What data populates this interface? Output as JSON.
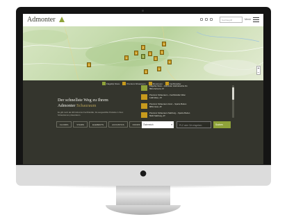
{
  "header": {
    "logo_text": "Admonter",
    "search_placeholder": "Suchbegriff",
    "menu_label": "Menü"
  },
  "map": {
    "markers": [
      "1",
      "1",
      "1",
      "2",
      "1",
      "1",
      "1",
      "1",
      "1",
      "1",
      "1",
      "1"
    ],
    "zoom_label": "+\n−"
  },
  "legend": {
    "items": [
      "Flagship Store",
      "Premium Showroom",
      "Showroom",
      "Fachhändler"
    ]
  },
  "hero": {
    "headline_line1": "Der schnellste Weg zu Ihrem",
    "headline_brand": "Admonter",
    "headline_accent": "Schauraum",
    "subtext": "Es gibt mehr als 400 Admonter Fachhändler, die ausgewählte Produkte in ihren Schauräumen präsentieren."
  },
  "filters": {
    "tabs": [
      "FLOORS",
      "STAIRS",
      "ELEMENTS",
      "ACOUSTICS",
      "DOORS",
      "IN"
    ]
  },
  "results": [
    {
      "title": "Flagship Store – Admonter Holzindustrie AG",
      "address": "8911 Admont, AT"
    },
    {
      "title": "Premium Schauraum – Fachhändler Wien",
      "address": "1100 Wien, AT"
    },
    {
      "title": "Premium Schauraum Graz – Sparte Boden",
      "address": "8051 Graz, AT"
    },
    {
      "title": "Premium Schauraum Salzburg – Sparte Boden",
      "address": "5020 Salzburg, AT"
    }
  ],
  "search": {
    "country_selected": "Österreich",
    "zip_placeholder": "PLZ oder Ort eingeben",
    "go_label": "Suchen"
  },
  "colors": {
    "accent_green": "#8fa33a",
    "marker_gold": "#c79a1d",
    "panel_dark": "#34352d"
  }
}
